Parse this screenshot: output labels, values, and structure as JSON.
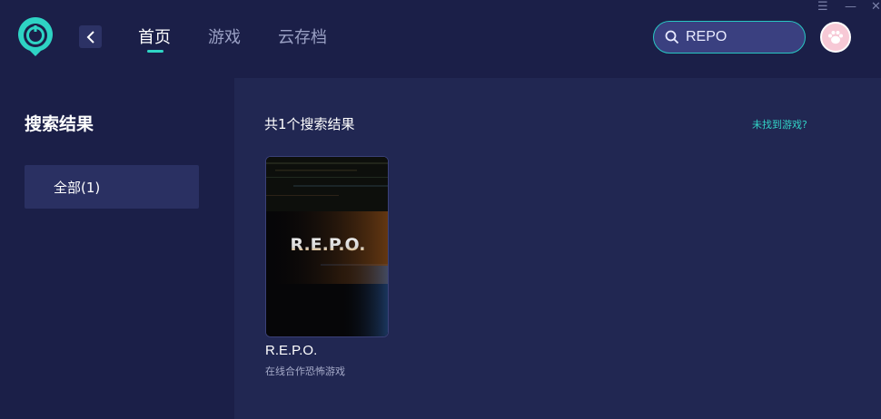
{
  "header": {
    "nav": [
      {
        "label": "首页",
        "active": true
      },
      {
        "label": "游戏",
        "active": false
      },
      {
        "label": "云存档",
        "active": false
      }
    ],
    "search": {
      "value": "REPO"
    },
    "window_controls": [
      "☰",
      "—",
      "✕"
    ],
    "accent_color": "#2fd6c6"
  },
  "sidebar": {
    "title": "搜索结果",
    "filters": [
      {
        "label": "全部(1)",
        "selected": true
      }
    ]
  },
  "main": {
    "result_count": "共1个搜索结果",
    "not_found_link": "未找到游戏?",
    "games": [
      {
        "cover_title": "R.E.P.O.",
        "name": "R.E.P.O.",
        "description": "在线合作恐怖游戏"
      }
    ]
  }
}
